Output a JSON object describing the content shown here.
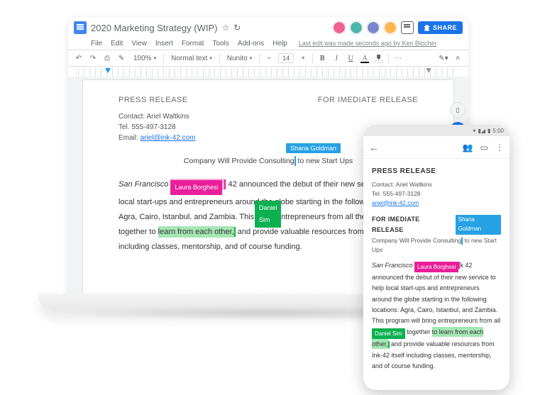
{
  "header": {
    "doc_title": "2020 Marketing Strategy (WIP)",
    "share_label": "SHARE"
  },
  "menus": {
    "file": "File",
    "edit": "Edit",
    "view": "View",
    "insert": "Insert",
    "format": "Format",
    "tools": "Tools",
    "addons": "Add-ons",
    "help": "Help",
    "last_edit": "Last edit was made seconds ago by Ken Blocher"
  },
  "toolbar": {
    "zoom": "100%",
    "style": "Normal text",
    "font": "Nunito",
    "font_size": "14",
    "bold": "B",
    "italic": "I",
    "underline": "U",
    "text_color": "A"
  },
  "doc": {
    "press_release": "PRESS RELEASE",
    "for_release": "FOR IMEDIATE RELEASE",
    "contact_label": "Contact: Ariel Waltkins",
    "tel_label": "Tel. 555-497-3128",
    "email_label": "Email: ",
    "email_value": "ariel@ink-42.com",
    "headline_a": "Company Will Provide Consulting",
    "headline_b": " to new Start Ups",
    "san_francisco": "San Francisco",
    "body_1a": " 42 announced the debut of their new service to help local start-ups and entrepreneurs around the globe starting in the following locations: Agra, Cairo, Istanbul, and Zambia. This progr",
    "body_1b": " entrepreneurs from all the locations together to ",
    "hl_learn": "learn from each other,",
    "body_1c": " and provide valuable resources from Ink-42 itself including classes, mentorship, and of course funding."
  },
  "collaborators": {
    "shana": "Shana Goldman",
    "laura": "Laura Borghesi",
    "daniel": "Daniel Sim"
  },
  "phone": {
    "time": "5:00",
    "para_a": "k 42 announced the debut of their new service to help local start-ups and entrepreneurs around the globe starting in the following locations: Agra, Cairo, Istanbul, and Zambia. This program will bring entrepreneurs from all ",
    "para_b": " together ",
    "hl_learn": "to learn from each other,",
    "para_c": " and provide valuable resources from Ink-42 itself including classes, mentorship, and of course funding."
  }
}
